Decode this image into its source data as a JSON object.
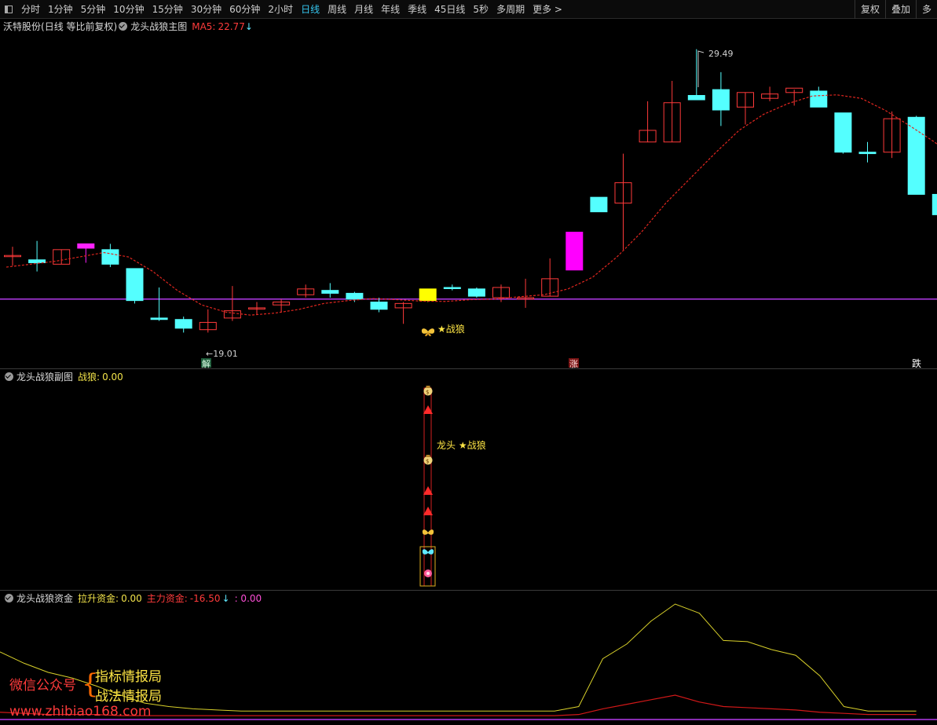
{
  "toolbar": {
    "periods": [
      "分时",
      "1分钟",
      "5分钟",
      "10分钟",
      "15分钟",
      "30分钟",
      "60分钟",
      "2小时",
      "日线",
      "周线",
      "月线",
      "年线",
      "季线",
      "45日线",
      "5秒",
      "多周期",
      "更多 >"
    ],
    "active_period": "日线",
    "right_buttons": [
      "复权",
      "叠加",
      "多"
    ]
  },
  "main_pane": {
    "stock_name": "沃特股份",
    "mode": "(日线 等比前复权)",
    "indicator": "龙头战狼主图",
    "ma_label": "MA5:",
    "ma_value": "22.77",
    "ma_arrow": "↓",
    "high_label": "29.49",
    "low_label": "←19.01",
    "signal_label": "★战狼",
    "markers": {
      "jie": "解",
      "zhang": "涨",
      "die": "跌"
    }
  },
  "sub_pane": {
    "indicator": "龙头战狼副图",
    "value_label": "战狼:",
    "value": "0.00",
    "signal_text": "龙头 ★战狼"
  },
  "fund_pane": {
    "indicator": "龙头战狼资金",
    "lift_label": "拉升资金:",
    "lift_value": "0.00",
    "main_label": "主力资金:",
    "main_value": "-16.50",
    "main_arrow": "↓",
    "extra_value": ": 0.00"
  },
  "watermark": {
    "label": "微信公众号",
    "line1": "指标情报局",
    "line2": "战法情报局",
    "url": "www.zhibiao168.com"
  },
  "chart_data": {
    "type": "candlestick",
    "up_color": "#ff3a3a",
    "down_color": "#54ffff",
    "ma_color": "#e0261f",
    "candles": [
      {
        "o": 22.4,
        "h": 22.7,
        "l": 22.05,
        "c": 22.4
      },
      {
        "o": 22.25,
        "h": 22.9,
        "l": 21.85,
        "c": 22.15
      },
      {
        "o": 22.1,
        "h": 22.6,
        "l": 22.1,
        "c": 22.6
      },
      {
        "o": 22.65,
        "h": 22.8,
        "l": 22.15,
        "c": 22.8
      },
      {
        "o": 22.6,
        "h": 22.8,
        "l": 22.0,
        "c": 22.1
      },
      {
        "o": 21.95,
        "h": 21.95,
        "l": 20.75,
        "c": 20.85
      },
      {
        "o": 20.25,
        "h": 21.3,
        "l": 20.15,
        "c": 20.2
      },
      {
        "o": 20.2,
        "h": 20.3,
        "l": 19.75,
        "c": 19.9
      },
      {
        "o": 19.85,
        "h": 20.55,
        "l": 19.75,
        "c": 20.1
      },
      {
        "o": 20.25,
        "h": 21.35,
        "l": 20.15,
        "c": 20.5
      },
      {
        "o": 20.6,
        "h": 20.8,
        "l": 20.35,
        "c": 20.6
      },
      {
        "o": 20.7,
        "h": 20.9,
        "l": 20.45,
        "c": 20.8
      },
      {
        "o": 21.05,
        "h": 21.4,
        "l": 20.95,
        "c": 21.25
      },
      {
        "o": 21.2,
        "h": 21.45,
        "l": 20.95,
        "c": 21.1
      },
      {
        "o": 21.1,
        "h": 21.15,
        "l": 20.8,
        "c": 20.9
      },
      {
        "o": 20.8,
        "h": 20.95,
        "l": 20.45,
        "c": 20.55
      },
      {
        "o": 20.6,
        "h": 20.8,
        "l": 20.05,
        "c": 20.75
      },
      {
        "o": 20.85,
        "h": 21.25,
        "l": 20.8,
        "c": 21.25
      },
      {
        "o": 21.3,
        "h": 21.4,
        "l": 21.2,
        "c": 21.27
      },
      {
        "o": 21.25,
        "h": 21.3,
        "l": 20.95,
        "c": 21.0
      },
      {
        "o": 20.95,
        "h": 21.4,
        "l": 20.8,
        "c": 21.3
      },
      {
        "o": 20.9,
        "h": 21.6,
        "l": 20.6,
        "c": 20.95
      },
      {
        "o": 21.0,
        "h": 22.3,
        "l": 21.0,
        "c": 21.6
      },
      {
        "o": 21.9,
        "h": 21.9,
        "l": 21.9,
        "c": 23.2
      },
      {
        "o": 24.4,
        "h": 24.4,
        "l": 24.0,
        "c": 23.9
      },
      {
        "o": 24.2,
        "h": 25.9,
        "l": 22.6,
        "c": 24.9
      },
      {
        "o": 26.3,
        "h": 27.7,
        "l": 26.3,
        "c": 26.7
      },
      {
        "o": 26.3,
        "h": 28.4,
        "l": 26.3,
        "c": 27.65
      },
      {
        "o": 27.9,
        "h": 29.49,
        "l": 27.9,
        "c": 27.75
      },
      {
        "o": 28.1,
        "h": 28.7,
        "l": 26.85,
        "c": 27.4
      },
      {
        "o": 27.5,
        "h": 28.0,
        "l": 26.9,
        "c": 28.0
      },
      {
        "o": 27.8,
        "h": 28.2,
        "l": 27.7,
        "c": 27.95
      },
      {
        "o": 28.0,
        "h": 28.1,
        "l": 27.55,
        "c": 28.15
      },
      {
        "o": 28.05,
        "h": 28.2,
        "l": 27.5,
        "c": 27.5
      },
      {
        "o": 27.3,
        "h": 27.3,
        "l": 25.9,
        "c": 25.95
      },
      {
        "o": 25.95,
        "h": 26.3,
        "l": 25.6,
        "c": 25.9
      },
      {
        "o": 25.95,
        "h": 27.35,
        "l": 25.75,
        "c": 27.1
      },
      {
        "o": 27.15,
        "h": 27.2,
        "l": 24.5,
        "c": 24.5
      },
      {
        "o": 24.5,
        "h": 24.5,
        "l": 23.8,
        "c": 23.8
      }
    ],
    "ma": [
      22.0,
      22.1,
      22.2,
      22.35,
      22.5,
      22.35,
      21.85,
      21.2,
      20.7,
      20.45,
      20.35,
      20.42,
      20.55,
      20.75,
      20.85,
      20.92,
      20.88,
      20.83,
      20.82,
      20.88,
      20.9,
      20.98,
      21.05,
      21.25,
      21.65,
      22.35,
      23.2,
      24.2,
      25.05,
      25.9,
      26.7,
      27.25,
      27.62,
      27.88,
      27.92,
      27.8,
      27.38,
      26.85,
      26.3,
      25.6
    ],
    "baseline": 20.9,
    "lift_fund": [
      0.58,
      0.48,
      0.4,
      0.35,
      0.28,
      0.2,
      0.13,
      0.1,
      0.08,
      0.07,
      0.06,
      0.06,
      0.06,
      0.06,
      0.06,
      0.06,
      0.06,
      0.06,
      0.06,
      0.06,
      0.06,
      0.06,
      0.06,
      0.06,
      0.1,
      0.52,
      0.65,
      0.85,
      1.0,
      0.92,
      0.68,
      0.67,
      0.6,
      0.55,
      0.37,
      0.1,
      0.06,
      0.06,
      0.06
    ],
    "main_fund": [
      0.05,
      0.04,
      0.03,
      0.03,
      0.03,
      0.02,
      0.02,
      0.02,
      0.02,
      0.02,
      0.02,
      0.02,
      0.02,
      0.02,
      0.02,
      0.02,
      0.02,
      0.02,
      0.02,
      0.02,
      0.02,
      0.02,
      0.02,
      0.02,
      0.03,
      0.08,
      0.12,
      0.16,
      0.2,
      0.14,
      0.1,
      0.09,
      0.08,
      0.07,
      0.05,
      0.04,
      0.03,
      0.03,
      0.03
    ]
  }
}
